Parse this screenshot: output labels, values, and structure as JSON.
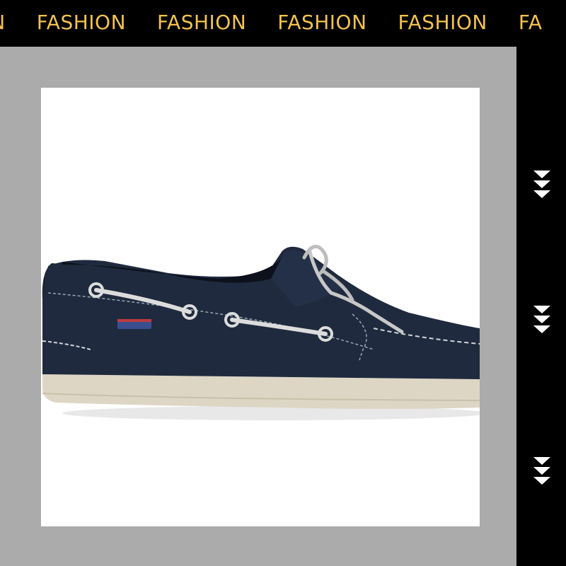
{
  "banner": {
    "words": [
      "ION",
      "FASHION",
      "FASHION",
      "FASHION",
      "FASHION",
      "FA"
    ],
    "text_color": "#f3c24f",
    "background": "#000000"
  },
  "product": {
    "image": "navy leather boat shoe with white laces and cream sole",
    "upper_color": "#1f2a3e",
    "sole_color": "#ddd6c4",
    "lace_color": "#d9d9d9"
  },
  "side_nav": {
    "icons": [
      "triple-chevron-down-icon",
      "triple-chevron-down-icon",
      "triple-chevron-down-icon"
    ],
    "icon_color": "#ffffff"
  },
  "frame": {
    "panel_color": "#ababab",
    "photo_background": "#ffffff"
  }
}
